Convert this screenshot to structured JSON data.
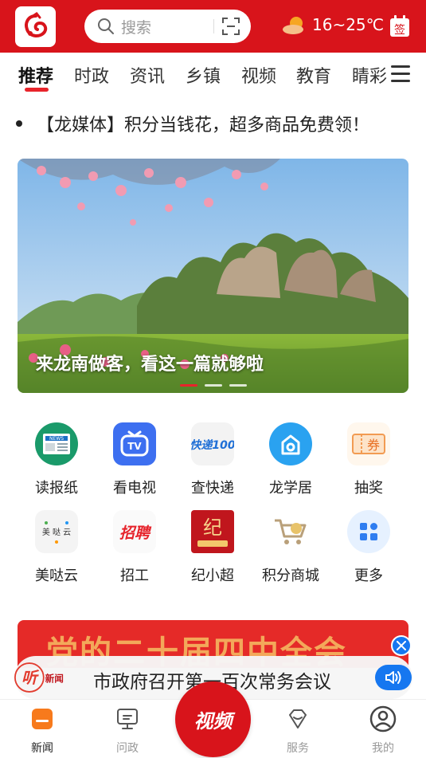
{
  "header": {
    "search_placeholder": "搜索",
    "weather_temp": "16~25℃",
    "signin_label": "签",
    "brand_color": "#d8141b"
  },
  "tabs": [
    {
      "label": "推荐",
      "active": true
    },
    {
      "label": "时政"
    },
    {
      "label": "资讯"
    },
    {
      "label": "乡镇"
    },
    {
      "label": "视频"
    },
    {
      "label": "教育"
    },
    {
      "label": "睛彩"
    }
  ],
  "notice": {
    "text": "【龙媒体】积分当钱花，超多商品免费领！"
  },
  "banner": {
    "caption": "来龙南做客，看这一篇就够啦",
    "slide_count": 3,
    "active_slide": 1
  },
  "services": [
    {
      "label": "读报纸",
      "icon": "newspaper-icon"
    },
    {
      "label": "看电视",
      "icon": "tv-icon"
    },
    {
      "label": "查快递",
      "icon": "express-icon",
      "icon_text": "快递100"
    },
    {
      "label": "龙学居",
      "icon": "house-icon"
    },
    {
      "label": "抽奖",
      "icon": "coupon-icon",
      "icon_text": "券"
    },
    {
      "label": "美哒云",
      "icon": "cloud-icon",
      "icon_text": "美 哒 云"
    },
    {
      "label": "招工",
      "icon": "recruit-icon",
      "icon_text": "招聘"
    },
    {
      "label": "纪小超",
      "icon": "discipline-icon",
      "icon_text": "纪"
    },
    {
      "label": "积分商城",
      "icon": "cart-icon"
    },
    {
      "label": "更多",
      "icon": "more-icon"
    }
  ],
  "promo": {
    "text": "党的二十届四中全会"
  },
  "audio_news": {
    "badge_main": "听",
    "badge_sub": "新闻",
    "headline": "市政府召开第一百次常务会议"
  },
  "bottom_nav": [
    {
      "label": "新闻",
      "icon": "news-icon",
      "active": true
    },
    {
      "label": "问政",
      "icon": "chat-icon"
    },
    {
      "label": "视频",
      "icon": "video-icon"
    },
    {
      "label": "服务",
      "icon": "diamond-icon"
    },
    {
      "label": "我的",
      "icon": "user-icon"
    }
  ]
}
